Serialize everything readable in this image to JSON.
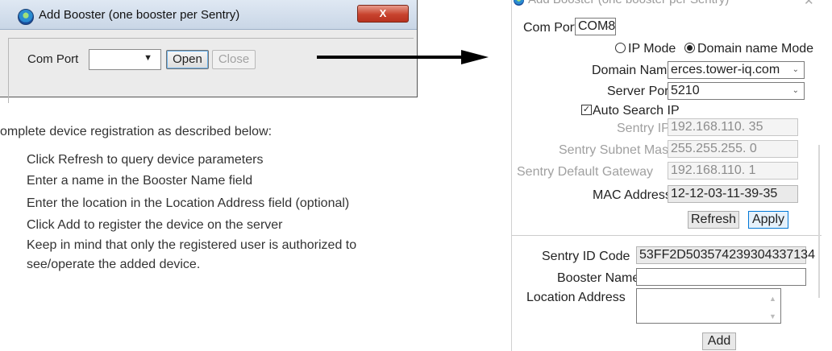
{
  "small_dialog": {
    "title": "Add Booster (one booster per Sentry)",
    "close_label": "X",
    "com_port_label": "Com Port",
    "com_port_value": "",
    "open_label": "Open",
    "close_button_label": "Close"
  },
  "instructions": {
    "intro": "omplete device registration as described below:",
    "steps": [
      "Click Refresh to query device parameters",
      "Enter a name in the Booster Name field",
      "Enter the location in the Location Address field (optional)",
      "Click Add to register the device on the server",
      "Keep in mind that only the registered user is authorized to",
      "see/operate the added device."
    ]
  },
  "big_dialog": {
    "title": "Add Booster (one booster per Sentry)",
    "close_label": "✕",
    "com_port_label": "Com Port",
    "com_port_value": "COM8",
    "ip_mode_label": "IP Mode",
    "domain_mode_label": "Domain name Mode",
    "domain_name_label": "Domain Name",
    "domain_name_value": "erces.tower-iq.com",
    "server_port_label": "Server Port",
    "server_port_value": "5210",
    "auto_search_label": "Auto Search IP",
    "sentry_ip_label": "Sentry IP",
    "sentry_ip_value": "192.168.110. 35",
    "subnet_label": "Sentry Subnet Mask",
    "subnet_value": "255.255.255. 0",
    "gateway_label": "Sentry Default Gateway",
    "gateway_value": "192.168.110. 1",
    "mac_label": "MAC Address",
    "mac_value": "12-12-03-11-39-35",
    "refresh_label": "Refresh",
    "apply_label": "Apply",
    "sentry_id_label": "Sentry ID Code",
    "sentry_id_value": "53FF2D503574239304337134",
    "booster_name_label": "Booster Name",
    "booster_name_value": "",
    "location_label": "Location Address",
    "location_value": "",
    "add_label": "Add"
  },
  "colors": {
    "close_button": "#c8432e",
    "focus_border": "#0078d7"
  }
}
